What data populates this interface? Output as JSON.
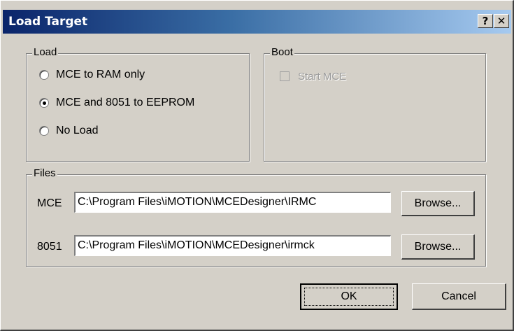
{
  "window": {
    "title": "Load Target",
    "help_label": "?",
    "close_label": "✕"
  },
  "load_group": {
    "legend": "Load",
    "options": [
      {
        "label": "MCE to RAM only",
        "selected": false
      },
      {
        "label": "MCE and 8051 to EEPROM",
        "selected": true
      },
      {
        "label": "No Load",
        "selected": false
      }
    ]
  },
  "boot_group": {
    "legend": "Boot",
    "start_mce_label": "Start MCE",
    "start_mce_checked": false,
    "enabled": false
  },
  "files_group": {
    "legend": "Files",
    "mce_label": "MCE",
    "mce_path": "C:\\Program Files\\iMOTION\\MCEDesigner\\IRMC",
    "i8051_label": "8051",
    "i8051_path": "C:\\Program Files\\iMOTION\\MCEDesigner\\irmck",
    "browse_label": "Browse..."
  },
  "buttons": {
    "ok_label": "OK",
    "cancel_label": "Cancel"
  }
}
